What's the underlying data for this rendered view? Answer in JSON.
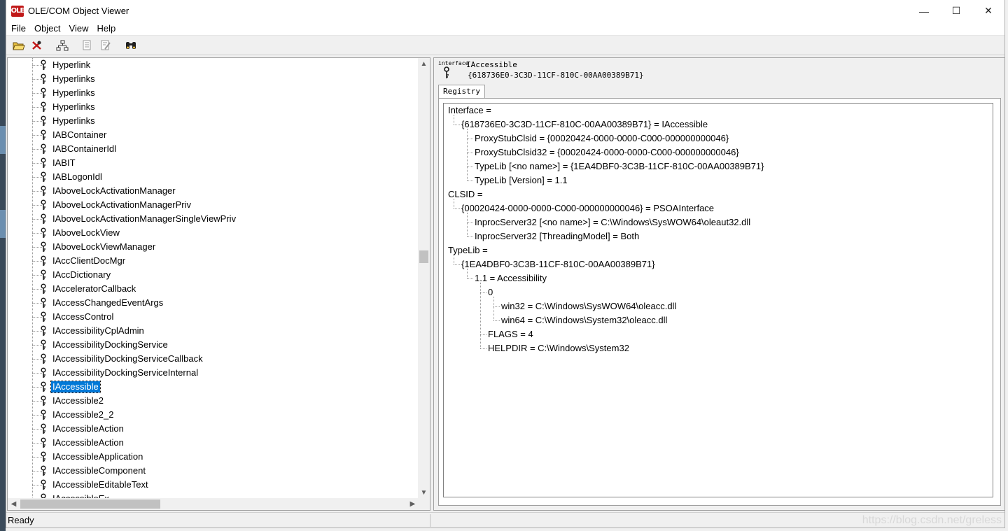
{
  "window": {
    "title": "OLE/COM Object Viewer",
    "app_icon_text": "OLE",
    "minimize": "—",
    "maximize": "☐",
    "close": "✕"
  },
  "menu": [
    "File",
    "Object",
    "View",
    "Help"
  ],
  "tree": {
    "items": [
      "Hyperlink",
      "Hyperlinks",
      "Hyperlinks",
      "Hyperlinks",
      "Hyperlinks",
      "IABContainer",
      "IABContainerIdl",
      "IABIT",
      "IABLogonIdl",
      "IAboveLockActivationManager",
      "IAboveLockActivationManagerPriv",
      "IAboveLockActivationManagerSingleViewPriv",
      "IAboveLockView",
      "IAboveLockViewManager",
      "IAccClientDocMgr",
      "IAccDictionary",
      "IAcceleratorCallback",
      "IAccessChangedEventArgs",
      "IAccessControl",
      "IAccessibilityCplAdmin",
      "IAccessibilityDockingService",
      "IAccessibilityDockingServiceCallback",
      "IAccessibilityDockingServiceInternal",
      "IAccessible",
      "IAccessible2",
      "IAccessible2_2",
      "IAccessibleAction",
      "IAccessibleAction",
      "IAccessibleApplication",
      "IAccessibleComponent",
      "IAccessibleEditableText",
      "IAccessibleEx"
    ],
    "selected_index": 23
  },
  "detail": {
    "interface_tag": "interface",
    "name": "IAccessible",
    "guid": "{618736E0-3C3D-11CF-810C-00AA00389B71}",
    "tab_label": "Registry",
    "registry": [
      {
        "text": "Interface =",
        "level": 0
      },
      {
        "text": "{618736E0-3C3D-11CF-810C-00AA00389B71} = IAccessible",
        "level": 1
      },
      {
        "text": "ProxyStubClsid = {00020424-0000-0000-C000-000000000046}",
        "level": 2
      },
      {
        "text": "ProxyStubClsid32 = {00020424-0000-0000-C000-000000000046}",
        "level": 2
      },
      {
        "text": "TypeLib [<no name>] = {1EA4DBF0-3C3B-11CF-810C-00AA00389B71}",
        "level": 2
      },
      {
        "text": "TypeLib [Version] = 1.1",
        "level": 2
      },
      {
        "text": "CLSID =",
        "level": 0
      },
      {
        "text": "{00020424-0000-0000-C000-000000000046} = PSOAInterface",
        "level": 1
      },
      {
        "text": "InprocServer32 [<no name>] = C:\\Windows\\SysWOW64\\oleaut32.dll",
        "level": 2
      },
      {
        "text": "InprocServer32 [ThreadingModel] = Both",
        "level": 2
      },
      {
        "text": "TypeLib =",
        "level": 0
      },
      {
        "text": "{1EA4DBF0-3C3B-11CF-810C-00AA00389B71}",
        "level": 1
      },
      {
        "text": "1.1 = Accessibility",
        "level": 2
      },
      {
        "text": "0",
        "level": 3
      },
      {
        "text": "win32 = C:\\Windows\\SysWOW64\\oleacc.dll",
        "level": 4
      },
      {
        "text": "win64 = C:\\Windows\\System32\\oleacc.dll",
        "level": 4
      },
      {
        "text": "FLAGS = 4",
        "level": 3
      },
      {
        "text": "HELPDIR = C:\\Windows\\System32",
        "level": 3
      }
    ]
  },
  "status": {
    "text": "Ready",
    "watermark": "https://blog.csdn.net/greless"
  },
  "colors": {
    "selection": "#0078d7",
    "icon_dark": "#1a1a1a"
  }
}
